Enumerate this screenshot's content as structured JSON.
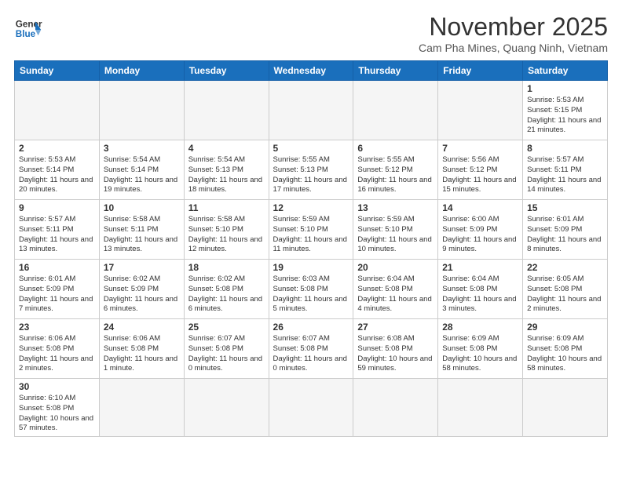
{
  "header": {
    "logo_general": "General",
    "logo_blue": "Blue",
    "month_title": "November 2025",
    "subtitle": "Cam Pha Mines, Quang Ninh, Vietnam"
  },
  "days_of_week": [
    "Sunday",
    "Monday",
    "Tuesday",
    "Wednesday",
    "Thursday",
    "Friday",
    "Saturday"
  ],
  "weeks": [
    [
      {
        "day": "",
        "info": ""
      },
      {
        "day": "",
        "info": ""
      },
      {
        "day": "",
        "info": ""
      },
      {
        "day": "",
        "info": ""
      },
      {
        "day": "",
        "info": ""
      },
      {
        "day": "",
        "info": ""
      },
      {
        "day": "1",
        "info": "Sunrise: 5:53 AM\nSunset: 5:15 PM\nDaylight: 11 hours\nand 21 minutes."
      }
    ],
    [
      {
        "day": "2",
        "info": "Sunrise: 5:53 AM\nSunset: 5:14 PM\nDaylight: 11 hours\nand 20 minutes."
      },
      {
        "day": "3",
        "info": "Sunrise: 5:54 AM\nSunset: 5:14 PM\nDaylight: 11 hours\nand 19 minutes."
      },
      {
        "day": "4",
        "info": "Sunrise: 5:54 AM\nSunset: 5:13 PM\nDaylight: 11 hours\nand 18 minutes."
      },
      {
        "day": "5",
        "info": "Sunrise: 5:55 AM\nSunset: 5:13 PM\nDaylight: 11 hours\nand 17 minutes."
      },
      {
        "day": "6",
        "info": "Sunrise: 5:55 AM\nSunset: 5:12 PM\nDaylight: 11 hours\nand 16 minutes."
      },
      {
        "day": "7",
        "info": "Sunrise: 5:56 AM\nSunset: 5:12 PM\nDaylight: 11 hours\nand 15 minutes."
      },
      {
        "day": "8",
        "info": "Sunrise: 5:57 AM\nSunset: 5:11 PM\nDaylight: 11 hours\nand 14 minutes."
      }
    ],
    [
      {
        "day": "9",
        "info": "Sunrise: 5:57 AM\nSunset: 5:11 PM\nDaylight: 11 hours\nand 13 minutes."
      },
      {
        "day": "10",
        "info": "Sunrise: 5:58 AM\nSunset: 5:11 PM\nDaylight: 11 hours\nand 13 minutes."
      },
      {
        "day": "11",
        "info": "Sunrise: 5:58 AM\nSunset: 5:10 PM\nDaylight: 11 hours\nand 12 minutes."
      },
      {
        "day": "12",
        "info": "Sunrise: 5:59 AM\nSunset: 5:10 PM\nDaylight: 11 hours\nand 11 minutes."
      },
      {
        "day": "13",
        "info": "Sunrise: 5:59 AM\nSunset: 5:10 PM\nDaylight: 11 hours\nand 10 minutes."
      },
      {
        "day": "14",
        "info": "Sunrise: 6:00 AM\nSunset: 5:09 PM\nDaylight: 11 hours\nand 9 minutes."
      },
      {
        "day": "15",
        "info": "Sunrise: 6:01 AM\nSunset: 5:09 PM\nDaylight: 11 hours\nand 8 minutes."
      }
    ],
    [
      {
        "day": "16",
        "info": "Sunrise: 6:01 AM\nSunset: 5:09 PM\nDaylight: 11 hours\nand 7 minutes."
      },
      {
        "day": "17",
        "info": "Sunrise: 6:02 AM\nSunset: 5:09 PM\nDaylight: 11 hours\nand 6 minutes."
      },
      {
        "day": "18",
        "info": "Sunrise: 6:02 AM\nSunset: 5:08 PM\nDaylight: 11 hours\nand 6 minutes."
      },
      {
        "day": "19",
        "info": "Sunrise: 6:03 AM\nSunset: 5:08 PM\nDaylight: 11 hours\nand 5 minutes."
      },
      {
        "day": "20",
        "info": "Sunrise: 6:04 AM\nSunset: 5:08 PM\nDaylight: 11 hours\nand 4 minutes."
      },
      {
        "day": "21",
        "info": "Sunrise: 6:04 AM\nSunset: 5:08 PM\nDaylight: 11 hours\nand 3 minutes."
      },
      {
        "day": "22",
        "info": "Sunrise: 6:05 AM\nSunset: 5:08 PM\nDaylight: 11 hours\nand 2 minutes."
      }
    ],
    [
      {
        "day": "23",
        "info": "Sunrise: 6:06 AM\nSunset: 5:08 PM\nDaylight: 11 hours\nand 2 minutes."
      },
      {
        "day": "24",
        "info": "Sunrise: 6:06 AM\nSunset: 5:08 PM\nDaylight: 11 hours\nand 1 minute."
      },
      {
        "day": "25",
        "info": "Sunrise: 6:07 AM\nSunset: 5:08 PM\nDaylight: 11 hours\nand 0 minutes."
      },
      {
        "day": "26",
        "info": "Sunrise: 6:07 AM\nSunset: 5:08 PM\nDaylight: 11 hours\nand 0 minutes."
      },
      {
        "day": "27",
        "info": "Sunrise: 6:08 AM\nSunset: 5:08 PM\nDaylight: 10 hours\nand 59 minutes."
      },
      {
        "day": "28",
        "info": "Sunrise: 6:09 AM\nSunset: 5:08 PM\nDaylight: 10 hours\nand 58 minutes."
      },
      {
        "day": "29",
        "info": "Sunrise: 6:09 AM\nSunset: 5:08 PM\nDaylight: 10 hours\nand 58 minutes."
      }
    ],
    [
      {
        "day": "30",
        "info": "Sunrise: 6:10 AM\nSunset: 5:08 PM\nDaylight: 10 hours\nand 57 minutes."
      },
      {
        "day": "",
        "info": ""
      },
      {
        "day": "",
        "info": ""
      },
      {
        "day": "",
        "info": ""
      },
      {
        "day": "",
        "info": ""
      },
      {
        "day": "",
        "info": ""
      },
      {
        "day": "",
        "info": ""
      }
    ]
  ]
}
